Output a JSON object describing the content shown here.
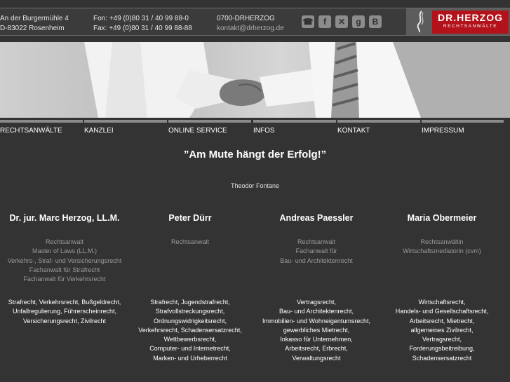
{
  "header": {
    "address": [
      "An der Burgermühle 4",
      "D-83022 Rosenheim"
    ],
    "phone": "Fon: +49 (0)80 31 / 40 99 88-0",
    "fax": "Fax: +49 (0)80 31 / 40 99 88-88",
    "short_number": "0700-DRHERZOG",
    "email": "kontakt@drherzog.de",
    "social": [
      {
        "icon": "phone-icon",
        "glyph": "☎"
      },
      {
        "icon": "facebook-icon",
        "glyph": "f"
      },
      {
        "icon": "xing-icon",
        "glyph": "✕"
      },
      {
        "icon": "google-icon",
        "glyph": "g"
      },
      {
        "icon": "blogger-icon",
        "glyph": "B"
      }
    ],
    "logo": {
      "name": "DR.HERZOG",
      "subtitle": "RECHTSANWÄLTE",
      "color": "#b3121b"
    }
  },
  "nav": [
    "RECHTSANWÄLTE",
    "KANZLEI",
    "ONLINE SERVICE",
    "INFOS",
    "KONTAKT",
    "IMPRESSUM"
  ],
  "quote": "”Am Mute hängt der Erfolg!”",
  "quote_author": "Theodor Fontane",
  "lawyers": [
    {
      "name": "Dr. jur. Marc Herzog, LL.M.",
      "titles": [
        "Rechtsanwalt",
        "Master of Laws (LL.M.)",
        "Verkehrs-, Straf- und Versicherungsrecht",
        "Fachanwalt für Strafrecht",
        "Fachanwalt für Verkehrsrecht"
      ],
      "areas": [
        "Strafrecht, Verkehrsrecht, Bußgeldrecht,",
        "Unfallregulierung, Führerscheinrecht,",
        "Versicherungsrecht, Zivilrecht"
      ]
    },
    {
      "name": "Peter Dürr",
      "titles": [
        "Rechtsanwalt"
      ],
      "areas": [
        "Strafrecht, Jugendstrafrecht,",
        "Strafvollstreckungsrecht,",
        "Ordnungswidrigkeitsrecht,",
        "Verkehrsrecht, Schadensersatzrecht,",
        "Wettbewerbsrecht,",
        "Computer- und Internetrecht,",
        "Marken- und Urheberrecht"
      ]
    },
    {
      "name": "Andreas Paessler",
      "titles": [
        "Rechtsanwalt",
        "Fachanwalt für",
        "Bau- und Architektenrecht"
      ],
      "areas": [
        "Vertragsrecht,",
        "Bau- und Architektenrecht,",
        "Immobilien- und Wohneigentumsrecht,",
        "gewerbliches Mietrecht,",
        "Inkasso für Unternehmen,",
        "Arbeitsrecht, Erbrecht,",
        "Verwaltungsrecht"
      ]
    },
    {
      "name": "Maria Obermeier",
      "titles": [
        "Rechtsanwältin",
        "Wirtschaftsmediatorin (cvm)"
      ],
      "areas": [
        "Wirtschaftsrecht,",
        "Handels- und Gesellschaftsrecht,",
        "Arbeitsrecht, Mietrecht,",
        "allgemeines Zivilrecht,",
        "Vertragsrecht,",
        "Forderungsbeitreibung,",
        "Schadensersatzrecht"
      ]
    }
  ]
}
